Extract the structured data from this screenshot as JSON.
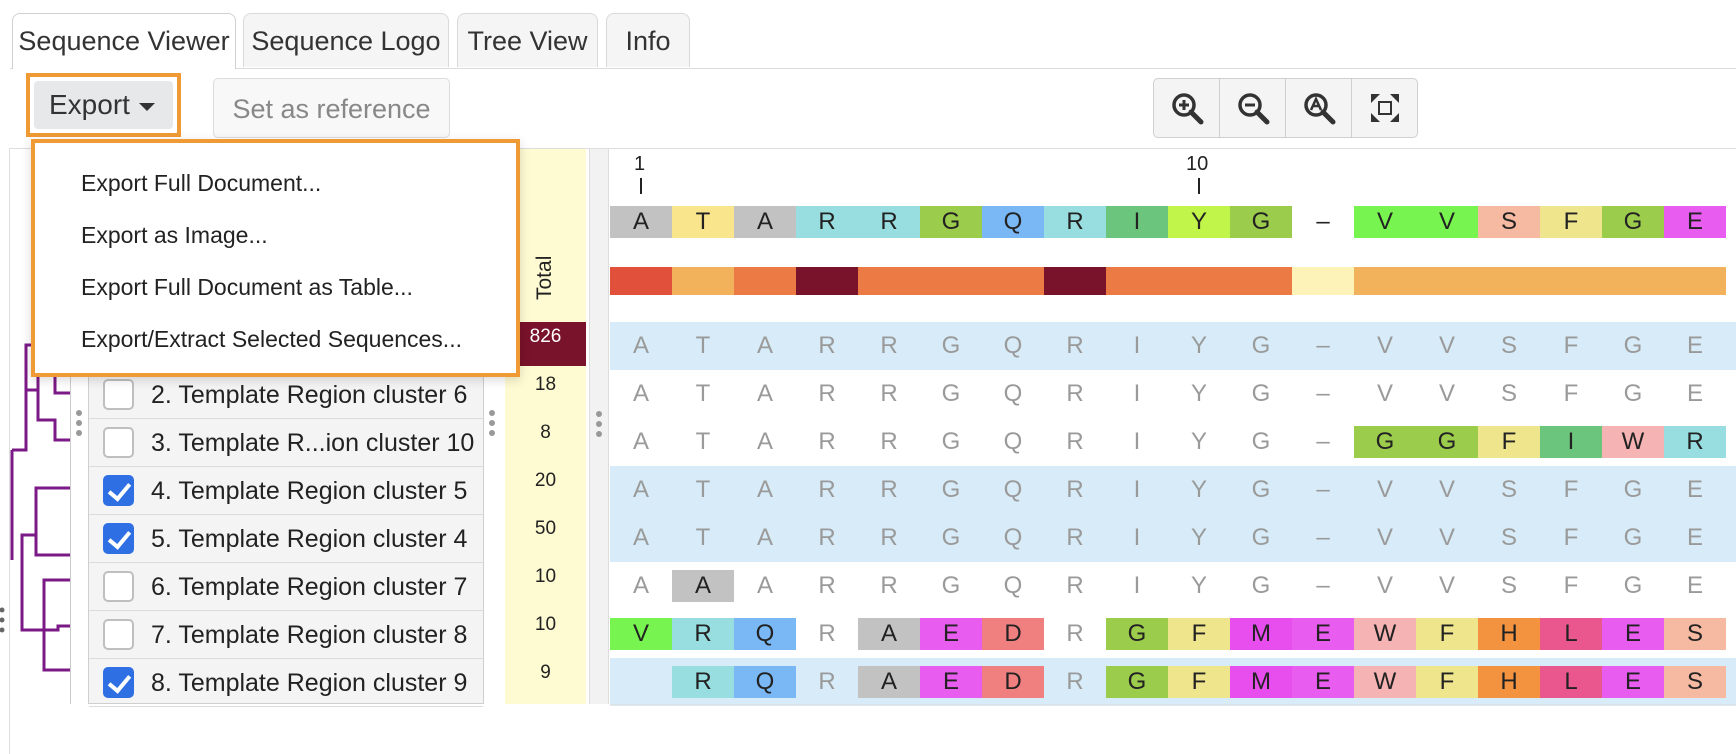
{
  "tabs": [
    "Sequence Viewer",
    "Sequence Logo",
    "Tree View",
    "Info"
  ],
  "toolbar": {
    "export_label": "Export",
    "set_reference_label": "Set as reference",
    "zoom_buttons": [
      "zoom-in-icon",
      "zoom-out-icon",
      "zoom-to-fit-icon",
      "fullscreen-icon"
    ]
  },
  "export_menu": [
    "Export Full Document...",
    "Export as Image...",
    "Export Full Document as Table...",
    "Export/Extract Selected Sequences..."
  ],
  "total_header": "Total",
  "ruler": [
    "1",
    "10"
  ],
  "consensus": [
    "A",
    "T",
    "A",
    "R",
    "R",
    "G",
    "Q",
    "R",
    "I",
    "Y",
    "G",
    "–",
    "V",
    "V",
    "S",
    "F",
    "G",
    "E"
  ],
  "first_total": "826",
  "rows": [
    {
      "name": "2. Template Region cluster 6",
      "checked": false,
      "total": "18"
    },
    {
      "name": "3. Template R...ion cluster 10",
      "checked": false,
      "total": "8"
    },
    {
      "name": "4. Template Region cluster 5",
      "checked": true,
      "total": "20"
    },
    {
      "name": "5. Template Region cluster 4",
      "checked": true,
      "total": "50"
    },
    {
      "name": "6. Template Region cluster 7",
      "checked": false,
      "total": "10"
    },
    {
      "name": "7. Template Region cluster 8",
      "checked": false,
      "total": "10"
    },
    {
      "name": "8. Template Region cluster 9",
      "checked": true,
      "total": "9"
    }
  ],
  "alignment": [
    [
      "A",
      "T",
      "A",
      "R",
      "R",
      "G",
      "Q",
      "R",
      "I",
      "Y",
      "G",
      "–",
      "V",
      "V",
      "S",
      "F",
      "G",
      "E"
    ],
    [
      "A",
      "T",
      "A",
      "R",
      "R",
      "G",
      "Q",
      "R",
      "I",
      "Y",
      "G",
      "–",
      "V",
      "V",
      "S",
      "F",
      "G",
      "E"
    ],
    [
      "A",
      "T",
      "A",
      "R",
      "R",
      "G",
      "Q",
      "R",
      "I",
      "Y",
      "G",
      "–",
      "G",
      "G",
      "F",
      "I",
      "W",
      "R"
    ],
    [
      "A",
      "T",
      "A",
      "R",
      "R",
      "G",
      "Q",
      "R",
      "I",
      "Y",
      "G",
      "–",
      "V",
      "V",
      "S",
      "F",
      "G",
      "E"
    ],
    [
      "A",
      "T",
      "A",
      "R",
      "R",
      "G",
      "Q",
      "R",
      "I",
      "Y",
      "G",
      "–",
      "V",
      "V",
      "S",
      "F",
      "G",
      "E"
    ],
    [
      "A",
      "A",
      "A",
      "R",
      "R",
      "G",
      "Q",
      "R",
      "I",
      "Y",
      "G",
      "–",
      "V",
      "V",
      "S",
      "F",
      "G",
      "E"
    ],
    [
      "V",
      "R",
      "Q",
      "R",
      "A",
      "E",
      "D",
      "R",
      "G",
      "F",
      "M",
      "E",
      "W",
      "F",
      "H",
      "L",
      "E",
      "S"
    ],
    [
      "",
      "R",
      "Q",
      "R",
      "A",
      "E",
      "D",
      "R",
      "G",
      "F",
      "M",
      "E",
      "W",
      "F",
      "H",
      "L",
      "E",
      "S"
    ]
  ],
  "colors": {
    "accent_highlight": "#f09a35",
    "checkbox_blue": "#2f6fe4",
    "row_selected": "#d7ecf8",
    "total_bg": "#fefad2",
    "tree_purple": "#7b1a86"
  }
}
